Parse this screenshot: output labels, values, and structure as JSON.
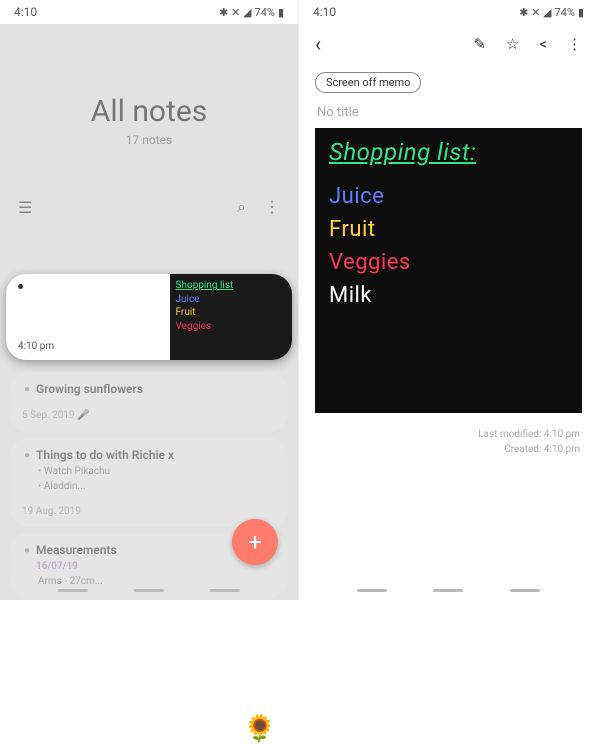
{
  "statusbar": {
    "time": "4:10",
    "battery": "74%",
    "icons": "✱ ✕ ◢ ▮"
  },
  "left": {
    "title": "All notes",
    "count": "17 notes",
    "floating": {
      "time": "4:10 pm",
      "lines": [
        "Shopping list",
        "Juice",
        "Fruit",
        "Veggies"
      ]
    },
    "notes": [
      {
        "title": "Growing sunflowers",
        "meta": "5 Sep. 2019  🎤"
      },
      {
        "title": "Things to do with Richie x",
        "items": [
          "Watch Pikachu",
          "Aladdin..."
        ],
        "meta": "19 Aug. 2019"
      },
      {
        "title": "Measurements",
        "subdate": "16/07/19",
        "sub": "Arms - 27cm..."
      }
    ]
  },
  "right": {
    "chip": "Screen off memo",
    "noTitle": "No title",
    "canvas": {
      "title": "Shopping list:",
      "items": [
        "Juice",
        "Fruit",
        "Veggies",
        "Milk"
      ]
    },
    "modified": "Last modified: 4:10 pm",
    "created": "Created: 4:10 pm"
  }
}
